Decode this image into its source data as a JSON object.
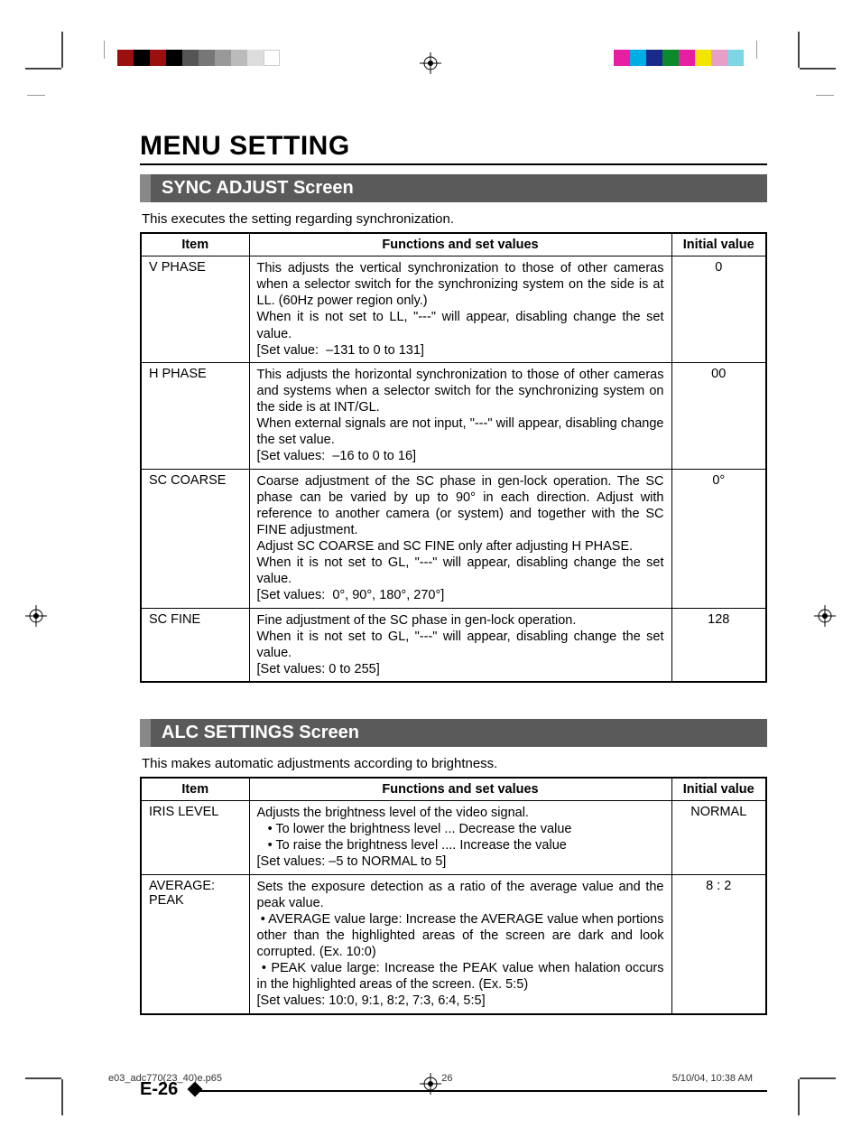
{
  "page_title": "MENU SETTING",
  "sections": [
    {
      "header": "SYNC ADJUST Screen",
      "intro": "This executes the setting regarding synchronization.",
      "table": {
        "headers": {
          "item": "Item",
          "func": "Functions and set values",
          "initial": "Initial value"
        },
        "rows": [
          {
            "item": "V PHASE",
            "desc": "This adjusts the vertical synchronization to those of other cameras when a selector switch for the synchronizing system on the side is at LL. (60Hz power region only.)\nWhen it is not set to LL, \"---\" will appear, disabling change the set value.\n[Set value:  –131 to 0 to 131]",
            "initial": "0"
          },
          {
            "item": "H PHASE",
            "desc": "This adjusts the horizontal synchronization to those of other cameras and systems when a selector switch for the synchronizing system on the side is at INT/GL.\nWhen external signals are not input, \"---\" will appear, disabling change the set value.\n[Set values:  –16 to 0 to 16]",
            "initial": "00"
          },
          {
            "item": "SC COARSE",
            "desc": "Coarse adjustment of the SC phase in gen-lock operation. The SC phase can be varied by up to 90° in each direction. Adjust with reference to another camera (or system) and together with the SC FINE adjustment.\nAdjust SC COARSE and SC FINE only after adjusting H PHASE.\nWhen it is not set to GL, \"---\" will appear, disabling change the set value.\n[Set values:  0°, 90°, 180°, 270°]",
            "initial": "0°"
          },
          {
            "item": "SC FINE",
            "desc": "Fine adjustment of the SC phase in gen-lock operation.\nWhen it is not set to GL, \"---\" will appear, disabling change the set value.\n[Set values: 0 to 255]",
            "initial": "128"
          }
        ]
      }
    },
    {
      "header": "ALC SETTINGS Screen",
      "intro": "This makes automatic adjustments according to brightness.",
      "table": {
        "headers": {
          "item": "Item",
          "func": "Functions and set values",
          "initial": "Initial value"
        },
        "rows": [
          {
            "item": "IRIS LEVEL",
            "desc": "Adjusts the brightness level of the video signal.\n   • To lower the brightness level ... Decrease the value\n   • To raise the brightness level .... Increase the value\n[Set values: –5 to NORMAL to 5]",
            "initial": "NORMAL"
          },
          {
            "item": "AVERAGE: PEAK",
            "desc": "Sets the exposure detection as a ratio of the average value and the peak value.\n • AVERAGE value large: Increase the AVERAGE value when portions other than the highlighted areas of the screen are dark and look corrupted. (Ex. 10:0)\n • PEAK value large: Increase the PEAK value when halation occurs in the highlighted areas of the screen. (Ex. 5:5)\n[Set values: 10:0, 9:1, 8:2, 7:3, 6:4, 5:5]",
            "initial": "8 : 2"
          }
        ]
      }
    }
  ],
  "page_number": "E-26",
  "footer": {
    "file": "e03_adc770(23_40)e.p65",
    "page": "26",
    "datetime": "5/10/04, 10:38 AM"
  },
  "colorbar_left": [
    "#9c0f0f",
    "#000",
    "#9c0f0f",
    "#000",
    "#555",
    "#777",
    "#999",
    "#bbb",
    "#ddd",
    "#fff"
  ],
  "colorbar_right": [
    "#e61ea1",
    "#00aee6",
    "#1a2a8a",
    "#0a8a2a",
    "#e61ea1",
    "#f2e600",
    "#e6a0c8",
    "#7fd4e6"
  ]
}
